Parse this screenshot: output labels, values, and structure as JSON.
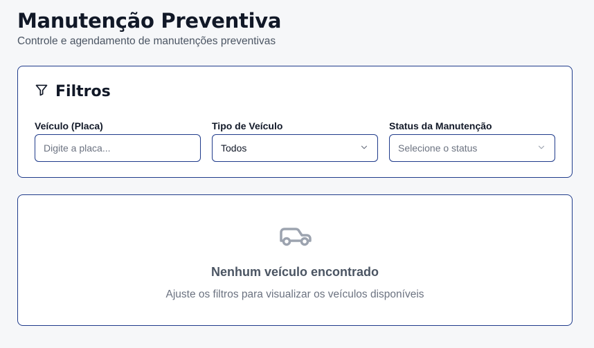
{
  "header": {
    "title": "Manutenção Preventiva",
    "subtitle": "Controle e agendamento de manutenções preventivas"
  },
  "filters": {
    "title": "Filtros",
    "icon": "filter-icon",
    "fields": {
      "plate": {
        "label": "Veículo (Placa)",
        "placeholder": "Digite a placa...",
        "value": ""
      },
      "vehicle_type": {
        "label": "Tipo de Veículo",
        "value": "Todos"
      },
      "status": {
        "label": "Status da Manutenção",
        "placeholder": "Selecione o status"
      }
    }
  },
  "empty_state": {
    "icon": "car-icon",
    "title": "Nenhum veículo encontrado",
    "message": "Ajuste os filtros para visualizar os veículos disponíveis"
  },
  "colors": {
    "accent_border": "#1e3a8a",
    "background": "#f6f7f9",
    "icon_gray": "#9ca3af"
  }
}
